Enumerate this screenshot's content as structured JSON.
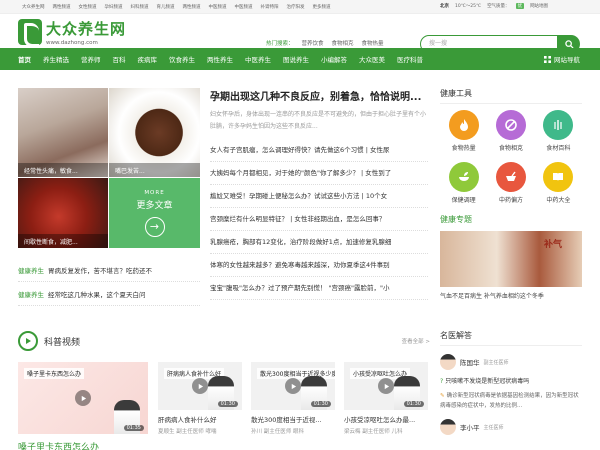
{
  "topbar": {
    "links": [
      "大众养生网",
      "两性频道",
      "女性频道",
      "孕妇频道",
      "妇科频道",
      "育儿频道",
      "两性频道",
      "中医频道",
      "中医频道",
      "补肾特阳",
      "治疗阳发",
      "更多频道"
    ],
    "city": "北京",
    "weather": "10℃～25℃",
    "air_label": "空气质量：",
    "air_value": "优",
    "sitemap": "网站地图"
  },
  "header": {
    "logo_title": "大众养生网",
    "logo_url": "www.dazhong.com",
    "hot_label": "热门搜索：",
    "hot_items": [
      "营养饮食",
      "食物相克",
      "食物热量"
    ],
    "search_placeholder": "搜一搜"
  },
  "nav": {
    "items": [
      "首页",
      "养生精选",
      "营养师",
      "百科",
      "疾病库",
      "饮食养生",
      "两性养生",
      "中医养生",
      "图说养生",
      "小编解答",
      "大众医美",
      "医疗科普"
    ],
    "sitemap": "网站导航"
  },
  "left": {
    "tiles": [
      {
        "caption": "经常性头痛，敏食..."
      },
      {
        "caption": "嘴巴发苦..."
      },
      {
        "caption": "间歇性断食，减肥..."
      }
    ],
    "more_en": "MORE",
    "more_cn": "更多文章",
    "list": [
      {
        "tag": "健康养生",
        "text": "胃病反复发作，苦不堪言？吃药还不"
      },
      {
        "tag": "健康养生",
        "text": "经常吃这几种水果，这个夏天白问"
      }
    ]
  },
  "feature": {
    "title": "孕期出现这几种不良反应，别着急，恰恰说明...",
    "summary": "妇女怀孕后，身体出现一连串的不良反应是不可避免的，但由于担心肚子里有个小肚腩，许多孕妈生怕因为这些不良反应...",
    "items": [
      "女人有子宫肌瘤，怎么调理好得快？请先做这6个习惯 | 女性尿",
      "大姨妈每个月都相见，对于她的\"颜色\"你了解多少？ | 女性到了",
      "尴尬又难受！孕期碰上便秘怎么办？试试这些小方法 | 10个女",
      "宫颈糜烂有什么明显特征？ | 女性非经期出血，是怎么回事？",
      "乳腺癌疮，胸部有12变化，治疗阶段做好1点，加速修复乳腺细",
      "体寒的女性越来越多？避免寒毒越来越深，劝你夏季这4件事别",
      "宝宝\"腹吸\"怎么办？过了预产期先别慌！ \"宫颈癌\"露脸前，\"小"
    ]
  },
  "right": {
    "tools_title": "健康工具",
    "tools": [
      {
        "label": "食物热量",
        "color": "#f39c1f"
      },
      {
        "label": "食物相克",
        "color": "#b66bd6"
      },
      {
        "label": "食材百科",
        "color": "#3fb98a"
      },
      {
        "label": "保健调理",
        "color": "#8fc93a"
      },
      {
        "label": "中药偏方",
        "color": "#e8573e"
      },
      {
        "label": "中药大全",
        "color": "#f1c40f"
      }
    ],
    "topic_title": "健康专题",
    "topic_seal": "补气",
    "topic_text": "气血不足百病生 补气养血相约这个冬季"
  },
  "videos": {
    "section_title": "科普视频",
    "more": "查看全部 >",
    "big_text": "嗓子里卡东西怎么办",
    "items": [
      {
        "banner": "嗓子里卡东西怎么办",
        "duration": "01:35",
        "title": "",
        "sub": ""
      },
      {
        "banner": "肝病病人食补什么好",
        "duration": "01:30",
        "title": "肝病病人食补什么好",
        "sub": "夏顺生  副主任医师  哮喘"
      },
      {
        "banner": "散光300度相当于近视多少度",
        "duration": "01:30",
        "title": "散光300度相当于近视...",
        "sub": "孙川  副主任医师  眼科"
      },
      {
        "banner": "小孩受凉呕吐怎么办",
        "duration": "01:30",
        "title": "小孩受凉呕吐怎么办最...",
        "sub": "梁云梅  副主任医师  儿科"
      }
    ]
  },
  "qa": {
    "title": "名医解答",
    "doctor1": {
      "name": "陈国华",
      "role": "副主任医师"
    },
    "question": "只咳嗽不发烧是新型冠状病毒吗",
    "answer": "确诊新型冠状病毒是依据基因检测结果，因为新型冠状病毒感染的症状中，发热的比例...",
    "doctor2": {
      "name": "李小平",
      "role": "主任医师"
    }
  },
  "colors": {
    "brand": "#3a9a38"
  }
}
